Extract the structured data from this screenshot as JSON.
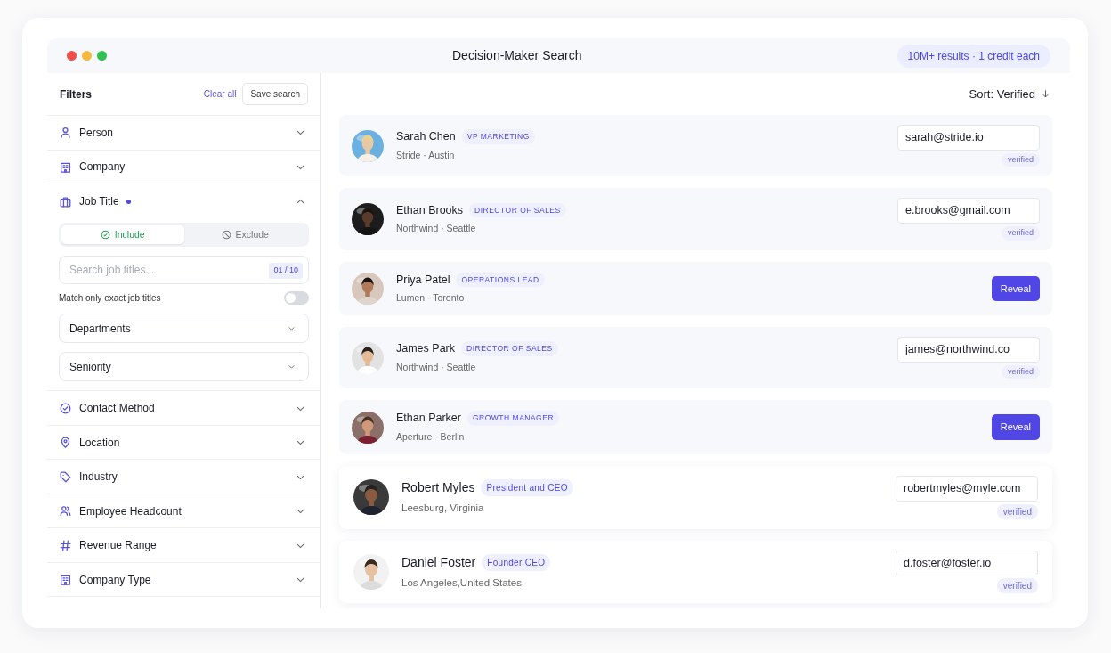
{
  "window": {
    "title": "Decision-Maker Search",
    "results_badge": "10M+ results · 1 credit each"
  },
  "sidebar": {
    "title": "Filters",
    "clear_link": "Clear all",
    "save_button": "Save search",
    "filters": [
      {
        "label": "Person",
        "expanded": false,
        "active": false
      },
      {
        "label": "Company",
        "expanded": false,
        "active": false
      },
      {
        "label": "Job Title",
        "expanded": true,
        "active": true,
        "panel": {
          "modes": [
            {
              "label": "Include",
              "selected": true
            },
            {
              "label": "Exclude",
              "selected": false
            }
          ],
          "search": {
            "placeholder": "Search job titles...",
            "counter": "01 / 10"
          },
          "toggle": {
            "label": "Match only exact job titles",
            "on": false
          },
          "selects": [
            "Departments",
            "Seniority"
          ]
        }
      },
      {
        "label": "Contact Method",
        "expanded": false,
        "active": false
      },
      {
        "label": "Location",
        "expanded": false,
        "active": false
      },
      {
        "label": "Industry",
        "expanded": false,
        "active": false
      },
      {
        "label": "Employee Headcount",
        "expanded": false,
        "active": false
      },
      {
        "label": "Revenue Range",
        "expanded": false,
        "active": false
      },
      {
        "label": "Company Type",
        "expanded": false,
        "active": false
      }
    ]
  },
  "results": {
    "sort": "Sort: Verified",
    "rows": [
      {
        "name": "Sarah Chen",
        "title": "VP MARKETING",
        "meta": "Stride · Austin",
        "kind": "email",
        "email": "sarah@stride.io",
        "status": "verified",
        "elevated": false
      },
      {
        "name": "Ethan Brooks",
        "title": "DIRECTOR OF SALES",
        "meta": "Northwind · Seattle",
        "kind": "email",
        "email": "e.brooks@gmail.com",
        "status": "verified",
        "elevated": false
      },
      {
        "name": "Priya Patel",
        "title": "OPERATIONS LEAD",
        "meta": "Lumen · Toronto",
        "kind": "reveal",
        "action": "Reveal",
        "elevated": false
      },
      {
        "name": "James Park",
        "title": "DIRECTOR OF SALES",
        "meta": "Northwind · Seattle",
        "kind": "email",
        "email": "james@northwind.co",
        "status": "verified",
        "elevated": false
      },
      {
        "name": "Ethan Parker",
        "title": "GROWTH MANAGER",
        "meta": "Aperture · Berlin",
        "kind": "reveal",
        "action": "Reveal",
        "elevated": false
      },
      {
        "name": "Robert Myles",
        "title": "President and CEO",
        "meta": "Leesburg, Virginia",
        "kind": "email",
        "email": "robertmyles@myle.com",
        "status": "verified",
        "elevated": true
      },
      {
        "name": "Daniel Foster",
        "title": "Founder CEO",
        "meta": "Los Angeles,United States",
        "kind": "email",
        "email": "d.foster@foster.io",
        "status": "verified",
        "elevated": true
      }
    ]
  }
}
